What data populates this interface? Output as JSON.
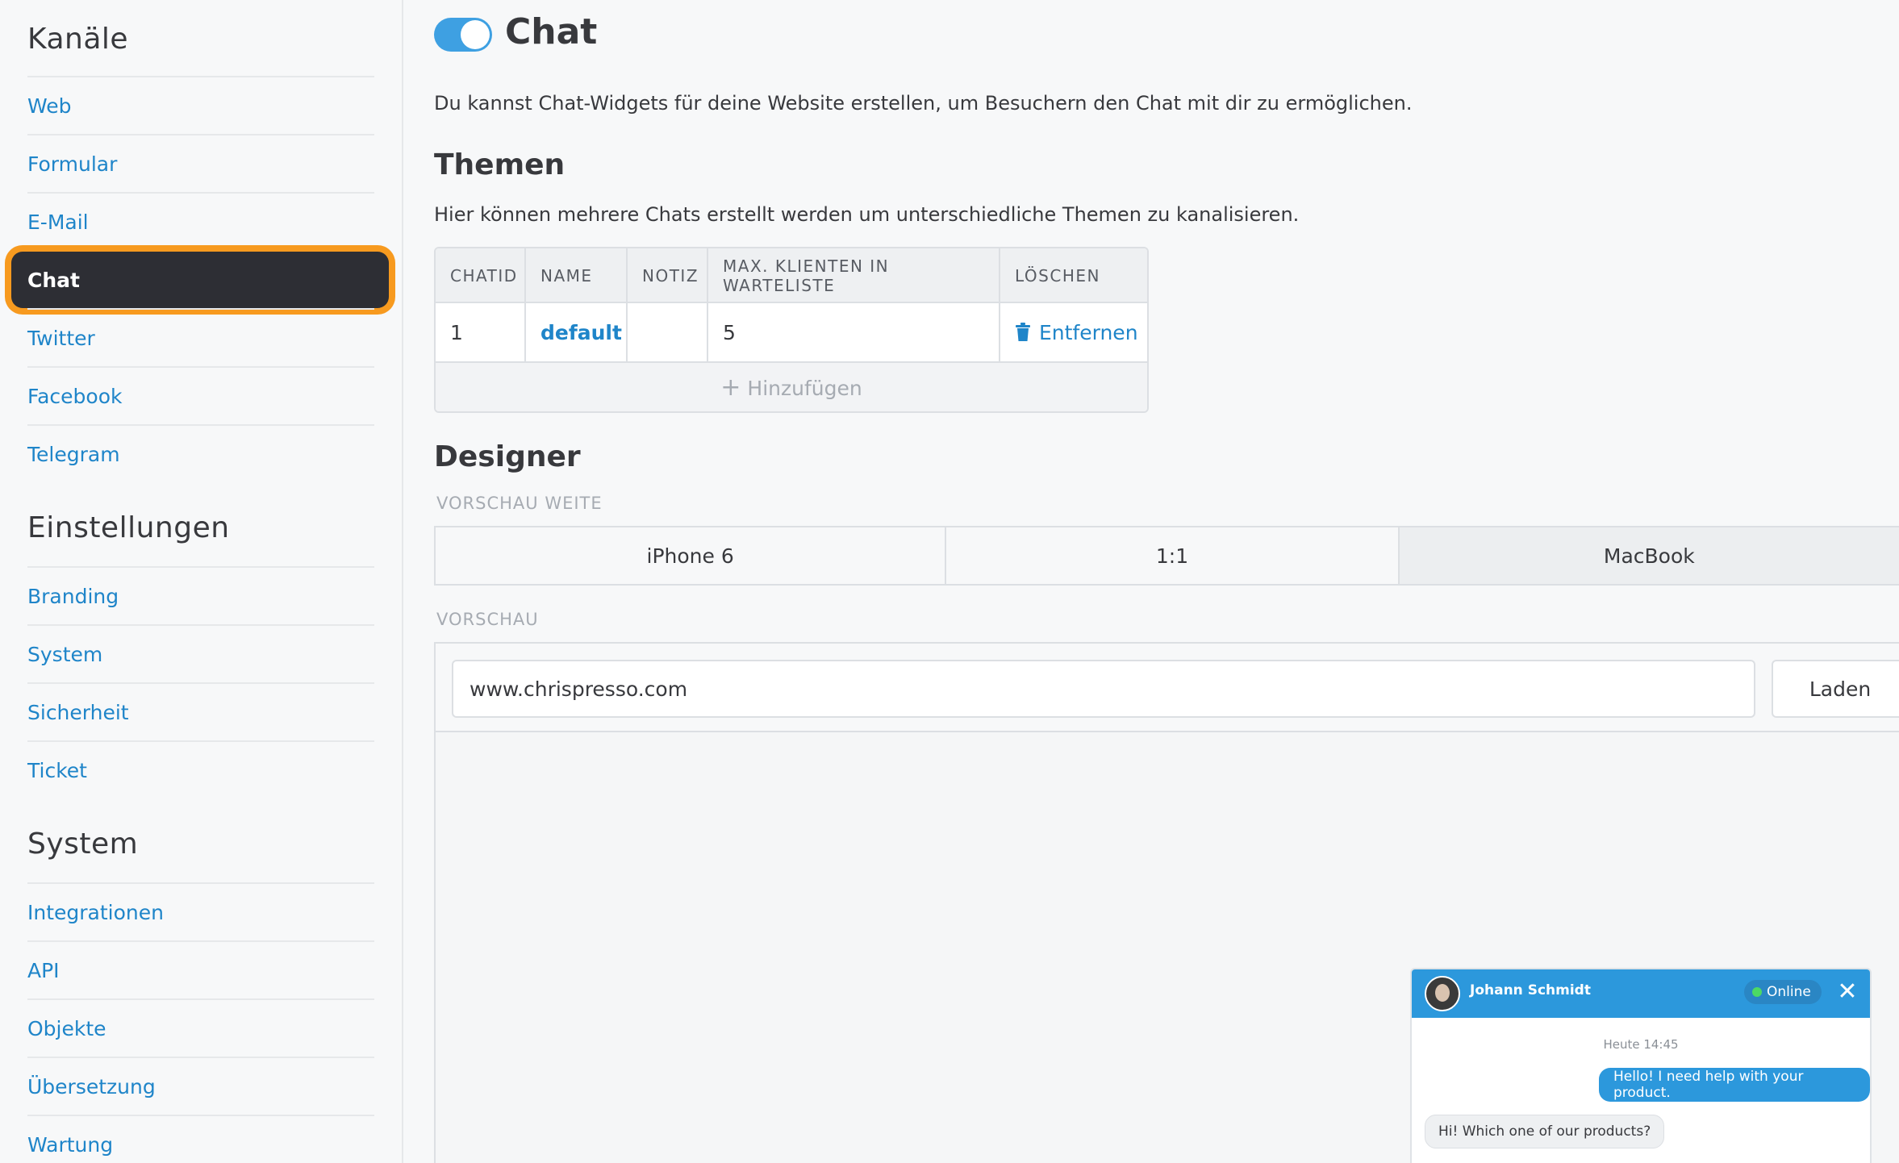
{
  "sidebar": {
    "sections": [
      {
        "title": "Kanäle",
        "items": [
          "Web",
          "Formular",
          "E-Mail",
          "Chat",
          "Twitter",
          "Facebook",
          "Telegram"
        ]
      },
      {
        "title": "Einstellungen",
        "items": [
          "Branding",
          "System",
          "Sicherheit",
          "Ticket"
        ]
      },
      {
        "title": "System",
        "items": [
          "Integrationen",
          "API",
          "Objekte",
          "Übersetzung",
          "Wartung"
        ]
      }
    ],
    "active_item": "Chat"
  },
  "main": {
    "title": "Chat",
    "toggle_on": true,
    "description": "Du kannst Chat-Widgets für deine Website erstellen, um Besuchern den Chat mit dir zu ermöglichen.",
    "themes": {
      "heading": "Themen",
      "description": "Hier können mehrere Chats erstellt werden um unterschiedliche Themen zu kanalisieren.",
      "columns": [
        "CHATID",
        "NAME",
        "NOTIZ",
        "MAX. KLIENTEN IN WARTELISTE",
        "LÖSCHEN"
      ],
      "rows": [
        {
          "chatid": "1",
          "name": "default",
          "note": "",
          "max_clients": "5",
          "delete_label": "Entfernen"
        }
      ],
      "add_label": "Hinzufügen"
    },
    "designer": {
      "heading": "Designer",
      "preview_width_label": "VORSCHAU WEITE",
      "width_options": [
        "iPhone 6",
        "1:1",
        "MacBook"
      ],
      "active_width": "MacBook",
      "preview_label": "VORSCHAU",
      "url_value": "www.chrispresso.com",
      "load_label": "Laden"
    }
  },
  "widget": {
    "agent_name": "Johann Schmidt",
    "status": "Online",
    "timestamp": "Heute 14:45",
    "messages": [
      {
        "from": "customer",
        "text": "Hello! I need help with your product."
      },
      {
        "from": "agent",
        "text": "Hi! Which one of our products?"
      }
    ]
  },
  "colors": {
    "accent": "#1f85c9",
    "active_nav_bg": "#2d2e34",
    "highlight_ring": "#f79a1f",
    "toggle": "#3ea0e2",
    "widget_header": "#2c98dc"
  }
}
